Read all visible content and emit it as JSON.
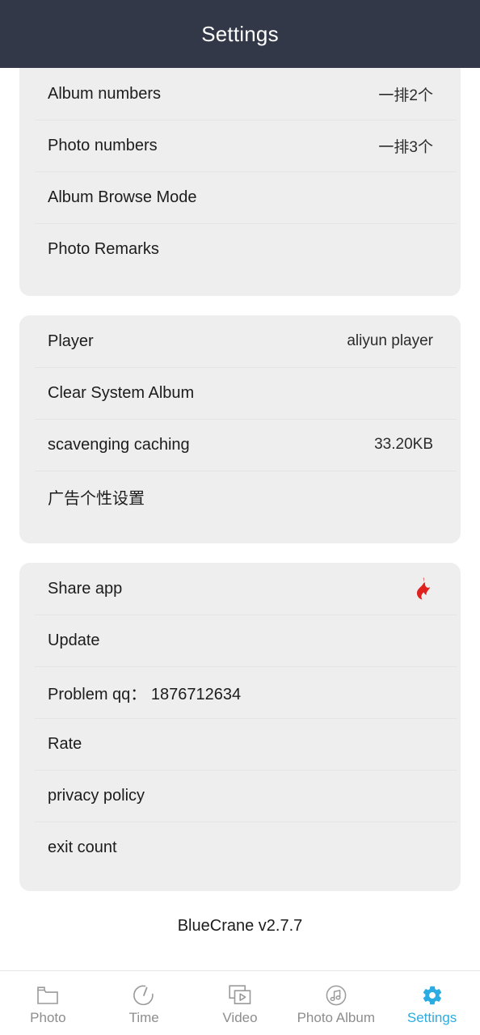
{
  "header": {
    "title": "Settings"
  },
  "colors": {
    "header_bg": "#323848",
    "card_bg": "#eeeeee",
    "page_bg": "#ffffff",
    "accent": "#2aace2",
    "flame": "#e0221f",
    "divider": "#e4e4e4",
    "label": "#1c1c1c",
    "inactive_tab": "#8d8d8d"
  },
  "sections": [
    {
      "name": "display-settings",
      "rows": [
        {
          "label": "Album numbers",
          "value": "一排2个",
          "icon": ""
        },
        {
          "label": "Photo numbers",
          "value": "一排3个",
          "icon": ""
        },
        {
          "label": "Album Browse Mode",
          "value": "",
          "icon": ""
        },
        {
          "label": "Photo Remarks",
          "value": "",
          "icon": ""
        }
      ]
    },
    {
      "name": "system-settings",
      "rows": [
        {
          "label": "Player",
          "value": "aliyun player",
          "icon": ""
        },
        {
          "label": "Clear System Album",
          "value": "",
          "icon": ""
        },
        {
          "label": "scavenging caching",
          "value": "33.20KB",
          "icon": ""
        },
        {
          "label": "广告个性设置",
          "value": "",
          "icon": ""
        }
      ]
    },
    {
      "name": "about-settings",
      "rows": [
        {
          "label": "Share app",
          "value": "",
          "icon": "flame-icon"
        },
        {
          "label": "Update",
          "value": "",
          "icon": ""
        },
        {
          "label": "Problem qq： 1876712634",
          "value": "",
          "icon": ""
        },
        {
          "label": "Rate",
          "value": "",
          "icon": ""
        },
        {
          "label": "privacy policy",
          "value": "",
          "icon": ""
        },
        {
          "label": "exit count",
          "value": "",
          "icon": ""
        }
      ]
    }
  ],
  "version": "BlueCrane v2.7.7",
  "tabbar": {
    "items": [
      {
        "label": "Photo",
        "icon": "folder-icon",
        "active": false
      },
      {
        "label": "Time",
        "icon": "clock-icon",
        "active": false
      },
      {
        "label": "Video",
        "icon": "video-icon",
        "active": false
      },
      {
        "label": "Photo Album",
        "icon": "music-note-icon",
        "active": false
      },
      {
        "label": "Settings",
        "icon": "gear-icon",
        "active": true
      }
    ]
  }
}
